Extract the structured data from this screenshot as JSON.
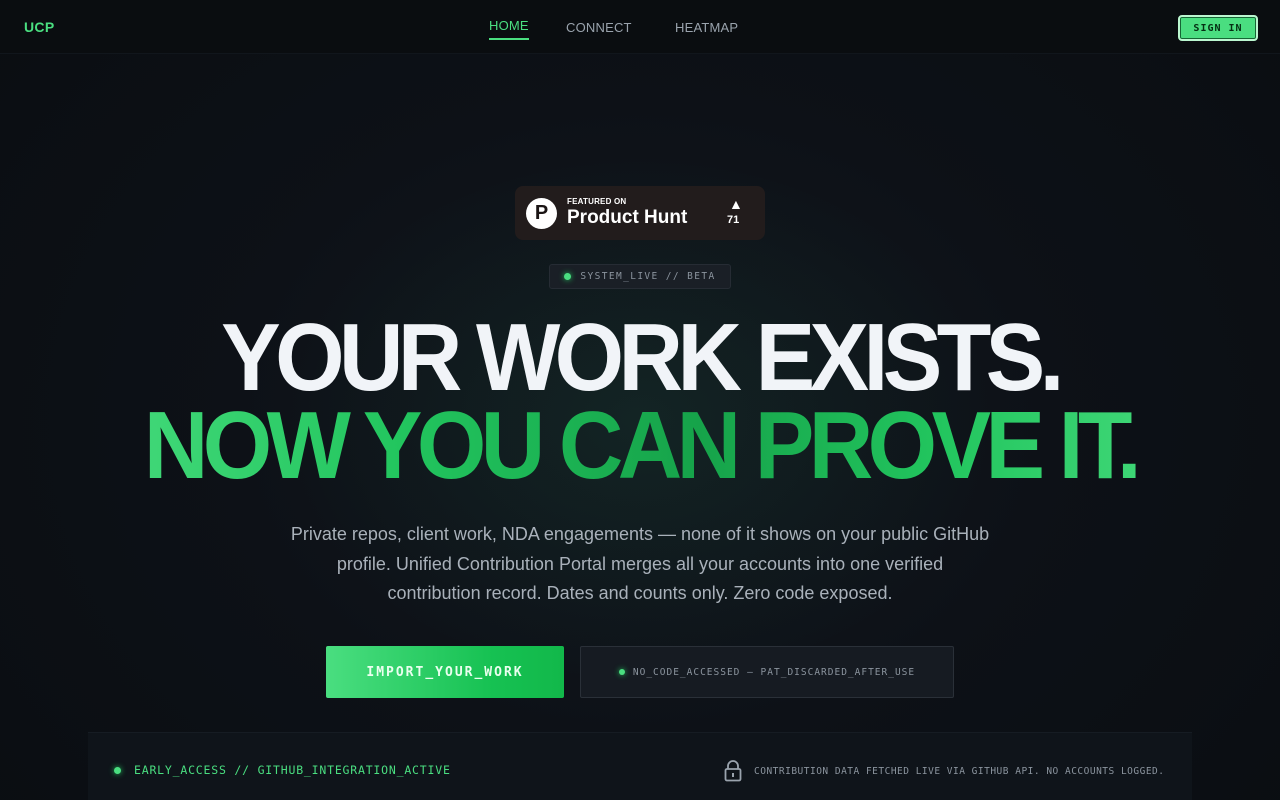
{
  "nav": {
    "logo": "UCP",
    "links": [
      {
        "label": "HOME",
        "active": true
      },
      {
        "label": "CONNECT",
        "active": false
      },
      {
        "label": "HEATMAP",
        "active": false
      }
    ],
    "sign_in": "SIGN IN"
  },
  "product_hunt": {
    "logo_letter": "P",
    "featured": "FEATURED ON",
    "name": "Product Hunt",
    "arrow": "▲",
    "count": "71"
  },
  "status_pill": "SYSTEM_LIVE // BETA",
  "headline": {
    "line1": "YOUR WORK EXISTS.",
    "line2": "NOW YOU CAN PROVE IT."
  },
  "description": "Private repos, client work, NDA engagements — none of it shows on your public GitHub profile. Unified Contribution Portal merges all your accounts into one verified contribution record. Dates and counts only. Zero code exposed.",
  "cta": {
    "primary": "IMPORT_YOUR_WORK",
    "privacy": "NO_CODE_ACCESSED — PAT_DISCARDED_AFTER_USE"
  },
  "bottom_bar": {
    "left": "EARLY_ACCESS // GITHUB_INTEGRATION_ACTIVE",
    "right": "CONTRIBUTION DATA FETCHED LIVE VIA GITHUB API. NO ACCOUNTS LOGGED."
  },
  "colors": {
    "accent": "#4ade80",
    "accent_dark": "#16a34a",
    "background": "#0d1117",
    "text": "#f1f4f8",
    "muted": "#8b949e"
  },
  "icons": [
    "product-hunt-logo",
    "upvote-arrow-icon",
    "status-dot-icon",
    "lock-icon"
  ]
}
